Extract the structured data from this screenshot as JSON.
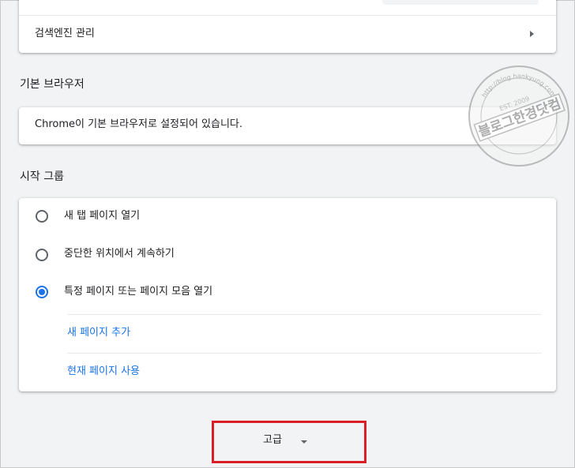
{
  "search_section": {
    "manage_search_engines_label": "검색엔진 관리"
  },
  "default_browser": {
    "section_title": "기본 브라우저",
    "status_text": "Chrome이 기본 브라우저로 설정되어 있습니다."
  },
  "on_startup": {
    "section_title": "시작 그룹",
    "options": [
      {
        "label": "새 탭 페이지 열기",
        "checked": false
      },
      {
        "label": "중단한 위치에서 계속하기",
        "checked": false
      },
      {
        "label": "특정 페이지 또는 페이지 모음 열기",
        "checked": true
      }
    ],
    "add_page_link": "새 페이지 추가",
    "use_current_pages_link": "현재 페이지 사용"
  },
  "advanced": {
    "label": "고급"
  },
  "watermark": {
    "text": "블로그한경닷컴",
    "arc_text": "http://blog.hankyung.com",
    "est_text": "EST. 2009"
  },
  "colors": {
    "accent_blue": "#1a73e8",
    "highlight_red": "#d81e26",
    "page_background": "#f1f3f4"
  }
}
